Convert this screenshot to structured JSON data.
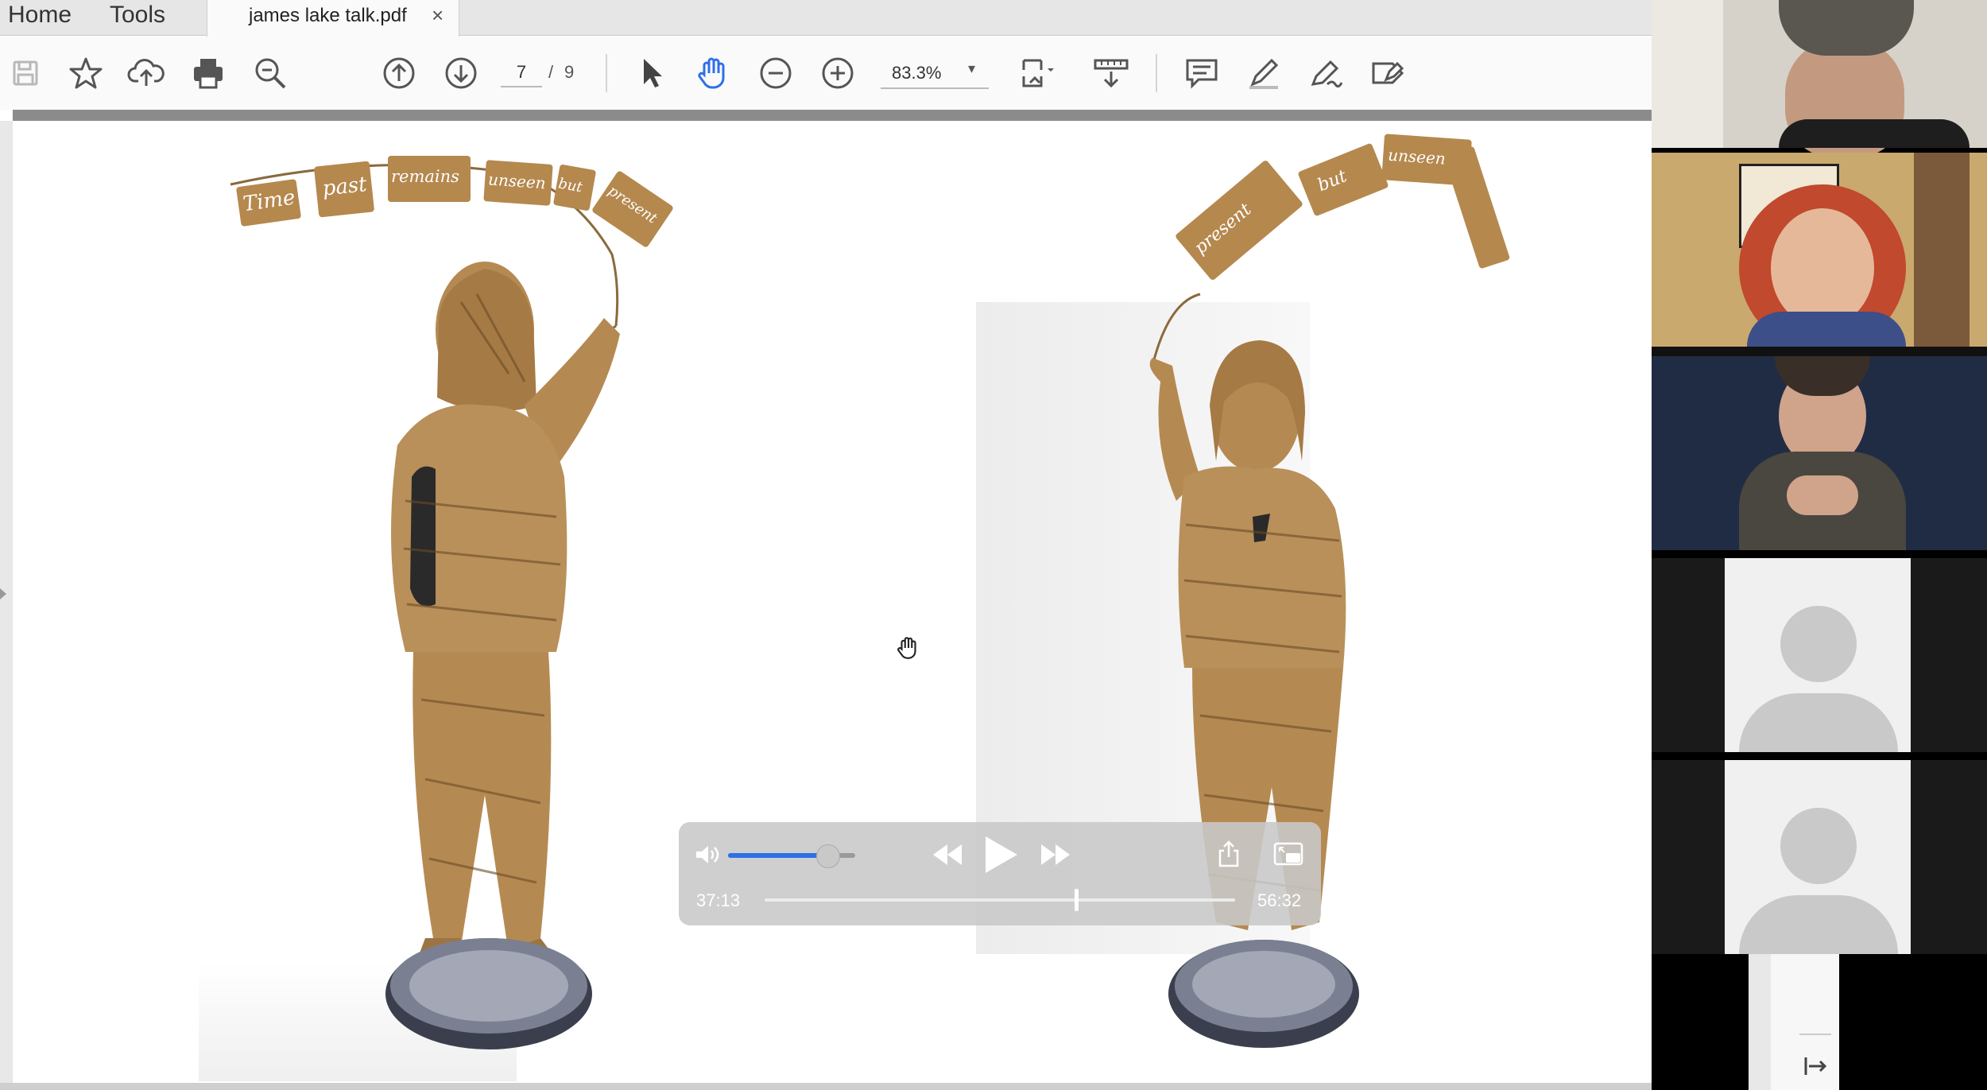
{
  "menu": {
    "home": "Home",
    "tools": "Tools"
  },
  "document_tab": {
    "title": "james lake talk.pdf",
    "close": "×"
  },
  "toolbar": {
    "page_current": "7",
    "page_separator": "/",
    "page_total": "9",
    "zoom": "83.3%",
    "zoom_caret": "▾"
  },
  "sculpture_left_banner": [
    "Time",
    "past",
    "remains",
    "unseen",
    "but",
    "present"
  ],
  "sculpture_right_banner": [
    "present",
    "but",
    "unseen"
  ],
  "video_player": {
    "elapsed": "37:13",
    "duration": "56:32",
    "volume": 0.78,
    "progress": 0.658
  },
  "participants": [
    {
      "kind": "video",
      "bg": "#d8d4cc"
    },
    {
      "kind": "video",
      "bg": "#c8a86c"
    },
    {
      "kind": "video",
      "bg": "#1f2c42"
    },
    {
      "kind": "avatar"
    },
    {
      "kind": "avatar"
    }
  ],
  "colors": {
    "accent_blue": "#2f6fe8",
    "cardboard": "#b5884e",
    "player_bg": "#c8c8c8"
  }
}
